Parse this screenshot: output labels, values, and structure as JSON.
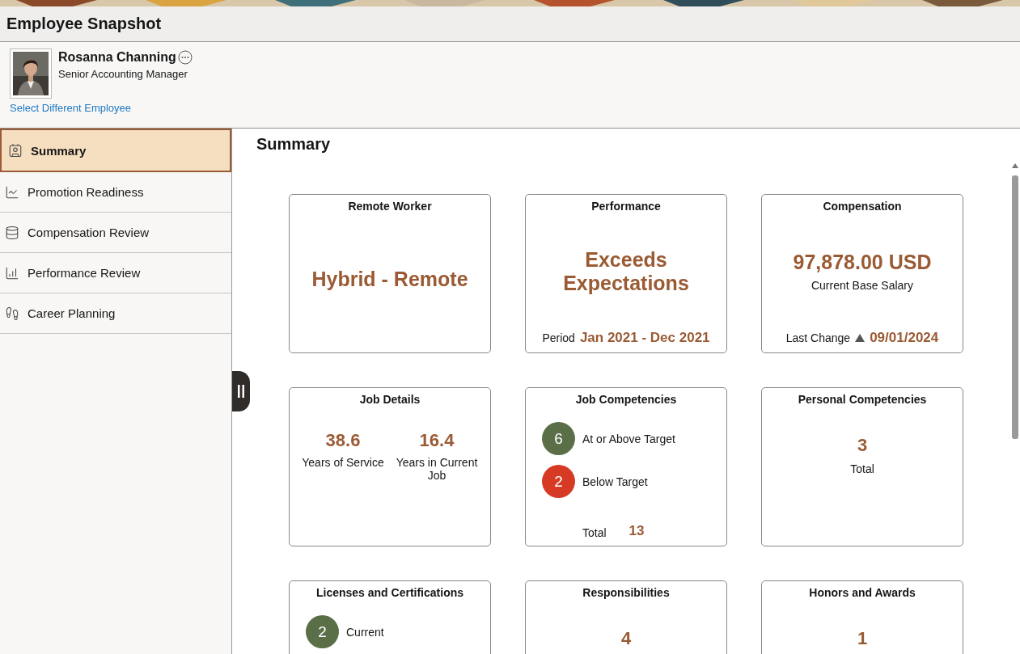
{
  "page": {
    "title": "Employee Snapshot"
  },
  "employee": {
    "name": "Rosanna Channing",
    "job_title": "Senior Accounting Manager",
    "link": "Select Different Employee"
  },
  "sidebar": {
    "items": [
      {
        "label": "Summary",
        "selected": true
      },
      {
        "label": "Promotion Readiness",
        "selected": false
      },
      {
        "label": "Compensation Review",
        "selected": false
      },
      {
        "label": "Performance Review",
        "selected": false
      },
      {
        "label": "Career Planning",
        "selected": false
      }
    ]
  },
  "content": {
    "heading": "Summary",
    "tiles": [
      {
        "kind": "headline",
        "title": "Remote Worker",
        "value": "Hybrid - Remote"
      },
      {
        "kind": "headline",
        "title": "Performance",
        "value": "Exceeds Expectations",
        "footer_label": "Period",
        "footer_value": "Jan 2021 - Dec 2021"
      },
      {
        "kind": "amount",
        "title": "Compensation",
        "value": "97,878.00 USD",
        "caption": "Current Base Salary",
        "footer_label": "Last Change",
        "footer_value": "09/01/2024"
      },
      {
        "kind": "stats",
        "title": "Job Details",
        "stats": [
          {
            "value": "38.6",
            "label": "Years of Service"
          },
          {
            "value": "16.4",
            "label": "Years in Current Job"
          }
        ]
      },
      {
        "kind": "badges",
        "title": "Job Competencies",
        "badges": [
          {
            "count": "6",
            "label": "At or Above Target",
            "color": "#5a6e48"
          },
          {
            "count": "2",
            "label": "Below Target",
            "color": "#d63a24"
          }
        ],
        "total_label": "Total",
        "total_value": "13"
      },
      {
        "kind": "count",
        "title": "Personal Competencies",
        "value": "3",
        "caption": "Total"
      },
      {
        "kind": "badges",
        "title": "Licenses and Certifications",
        "badges": [
          {
            "count": "2",
            "label": "Current",
            "color": "#5a6e48"
          }
        ]
      },
      {
        "kind": "count",
        "title": "Responsibilities",
        "value": "4"
      },
      {
        "kind": "count",
        "title": "Honors and Awards",
        "value": "1"
      }
    ]
  }
}
